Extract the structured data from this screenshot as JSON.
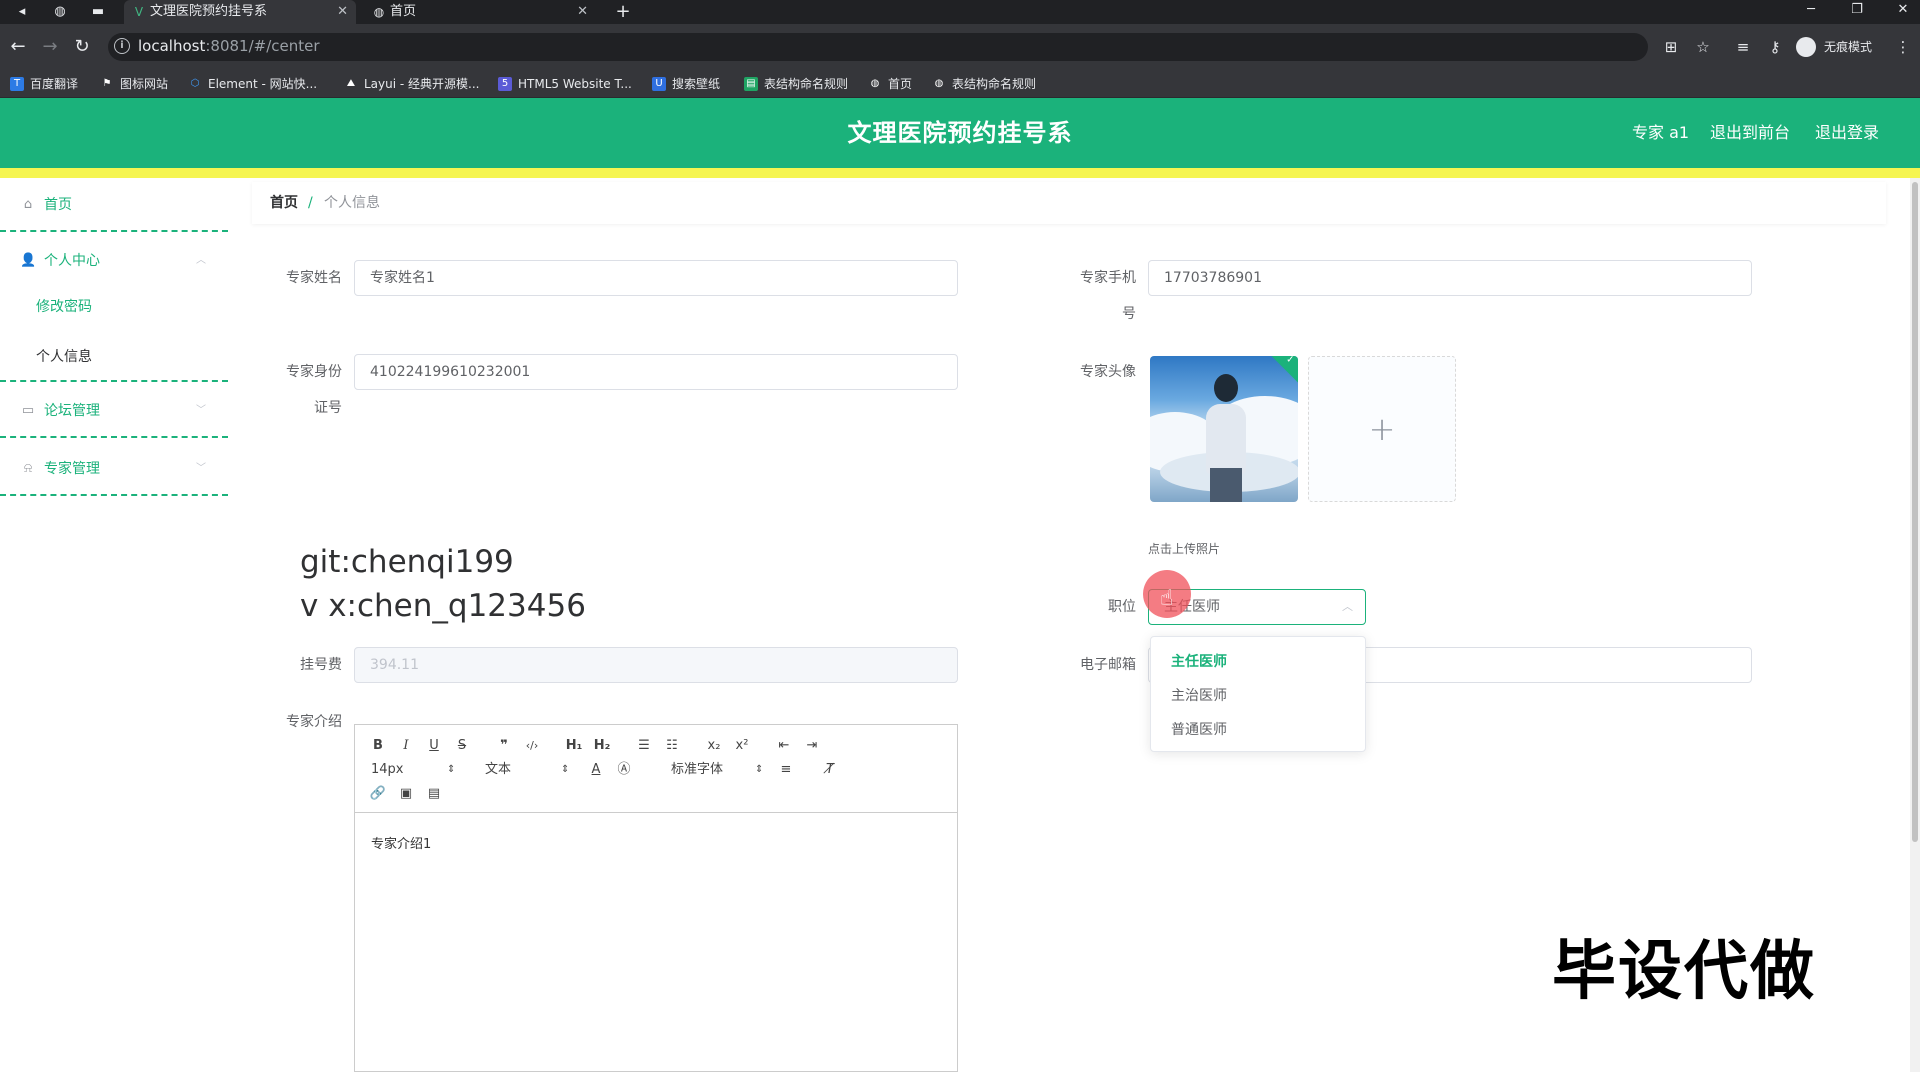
{
  "browser": {
    "tabs": [
      {
        "title": "文理医院预约挂号系",
        "icon": "vue-icon",
        "active": true
      },
      {
        "title": "首页",
        "icon": "globe-icon",
        "active": false
      }
    ],
    "url_host": "localhost",
    "url_rest": ":8081/#/center",
    "incognito_label": "无痕模式",
    "bookmarks": [
      {
        "label": "百度翻译",
        "icon_color": "#2d7be5"
      },
      {
        "label": "图标网站",
        "icon_color": "#ffffff"
      },
      {
        "label": "Element - 网站快...",
        "icon_color": "#409eff"
      },
      {
        "label": "Layui - 经典开源模...",
        "icon_color": "#ffffff"
      },
      {
        "label": "HTML5 Website T...",
        "icon_color": "#5b5bd6"
      },
      {
        "label": "搜索壁纸",
        "icon_color": "#2f6fe0"
      },
      {
        "label": "表结构命名规则",
        "icon_color": "#1fa463"
      },
      {
        "label": "首页",
        "icon_color": "#ffffff"
      },
      {
        "label": "表结构命名规则",
        "icon_color": "#ffffff"
      }
    ]
  },
  "header": {
    "title": "文理医院预约挂号系",
    "user": "专家 a1",
    "back_front": "退出到前台",
    "logout": "退出登录",
    "accent": "#1bb27b",
    "stripe": "#f5f551"
  },
  "sidebar": {
    "home": "首页",
    "personal_center": "个人中心",
    "change_password": "修改密码",
    "personal_info": "个人信息",
    "forum": "论坛管理",
    "expert": "专家管理"
  },
  "breadcrumb": {
    "home": "首页",
    "sep": "/",
    "current": "个人信息"
  },
  "form": {
    "name_label": "专家姓名",
    "name_value": "专家姓名1",
    "phone_label_1": "专家手机",
    "phone_label_2": "号",
    "phone_value": "17703786901",
    "id_label_1": "专家身份",
    "id_label_2": "证号",
    "id_value": "410224199610232001",
    "avatar_label": "专家头像",
    "upload_tip": "点击上传照片",
    "position_label": "职位",
    "position_value": "主任医师",
    "position_options": [
      "主任医师",
      "主治医师",
      "普通医师"
    ],
    "fee_label": "挂号费",
    "fee_value": "394.11",
    "email_label": "电子邮箱",
    "intro_label": "专家介绍",
    "intro_value": "专家介绍1"
  },
  "editor": {
    "font_size": "14px",
    "header_picker": "文本",
    "font_picker": "标准字体"
  },
  "overlay": {
    "watermark_line1": "git:chenqi199",
    "watermark_line2": "v x:chen_q123456",
    "promo": "毕设代做"
  }
}
